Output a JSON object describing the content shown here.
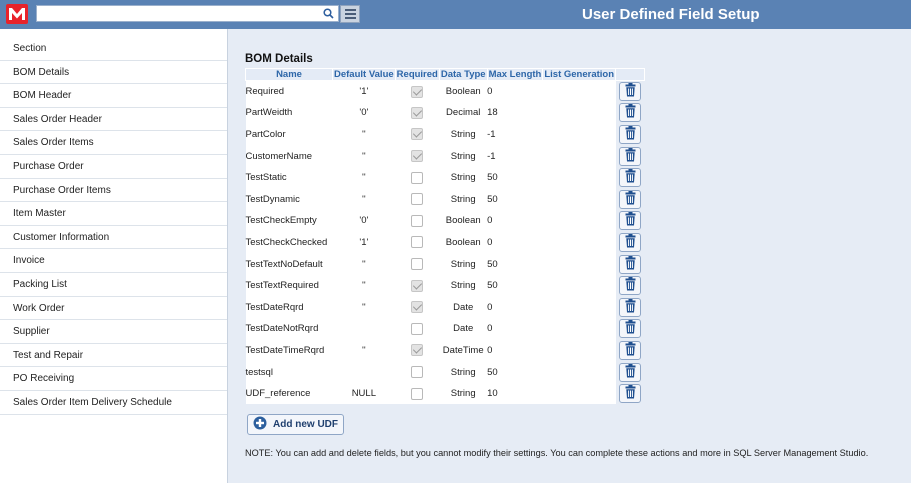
{
  "header": {
    "title": "User Defined Field Setup",
    "search_placeholder": "",
    "logo_icon": "m-logo-icon",
    "search_icon": "search-icon",
    "menu_icon": "hamburger-menu-icon"
  },
  "sidebar": {
    "items": [
      {
        "label": "Section"
      },
      {
        "label": "BOM Details"
      },
      {
        "label": "BOM Header"
      },
      {
        "label": "Sales Order Header"
      },
      {
        "label": "Sales Order Items"
      },
      {
        "label": "Purchase Order"
      },
      {
        "label": "Purchase Order Items"
      },
      {
        "label": "Item Master"
      },
      {
        "label": "Customer Information"
      },
      {
        "label": "Invoice"
      },
      {
        "label": "Packing List"
      },
      {
        "label": "Work Order"
      },
      {
        "label": "Supplier"
      },
      {
        "label": "Test and Repair"
      },
      {
        "label": "PO Receiving"
      },
      {
        "label": "Sales Order Item Delivery Schedule"
      }
    ]
  },
  "main": {
    "section_title": "BOM Details",
    "columns": [
      "Name",
      "Default Value",
      "Required",
      "Data Type",
      "Max Length",
      "List Generation"
    ],
    "rows": [
      {
        "name": "Required",
        "default": "'1'",
        "required": true,
        "type": "Boolean",
        "max": "0",
        "list": ""
      },
      {
        "name": "PartWeidth",
        "default": "'0'",
        "required": true,
        "type": "Decimal",
        "max": "18",
        "list": ""
      },
      {
        "name": "PartColor",
        "default": "''",
        "required": true,
        "type": "String",
        "max": "-1",
        "list": ""
      },
      {
        "name": "CustomerName",
        "default": "''",
        "required": true,
        "type": "String",
        "max": "-1",
        "list": ""
      },
      {
        "name": "TestStatic",
        "default": "''",
        "required": false,
        "type": "String",
        "max": "50",
        "list": ""
      },
      {
        "name": "TestDynamic",
        "default": "''",
        "required": false,
        "type": "String",
        "max": "50",
        "list": ""
      },
      {
        "name": "TestCheckEmpty",
        "default": "'0'",
        "required": false,
        "type": "Boolean",
        "max": "0",
        "list": ""
      },
      {
        "name": "TestCheckChecked",
        "default": "'1'",
        "required": false,
        "type": "Boolean",
        "max": "0",
        "list": ""
      },
      {
        "name": "TestTextNoDefault",
        "default": "''",
        "required": false,
        "type": "String",
        "max": "50",
        "list": ""
      },
      {
        "name": "TestTextRequired",
        "default": "''",
        "required": true,
        "type": "String",
        "max": "50",
        "list": ""
      },
      {
        "name": "TestDateRqrd",
        "default": "''",
        "required": true,
        "type": "Date",
        "max": "0",
        "list": ""
      },
      {
        "name": "TestDateNotRqrd",
        "default": "",
        "required": false,
        "type": "Date",
        "max": "0",
        "list": ""
      },
      {
        "name": "TestDateTimeRqrd",
        "default": "''",
        "required": true,
        "type": "DateTime",
        "max": "0",
        "list": ""
      },
      {
        "name": "testsql",
        "default": "",
        "required": false,
        "type": "String",
        "max": "50",
        "list": ""
      },
      {
        "name": "UDF_reference",
        "default": "NULL",
        "required": false,
        "type": "String",
        "max": "10",
        "list": ""
      }
    ],
    "delete_icon": "trash-icon",
    "add_button_label": "Add new UDF",
    "add_icon": "plus-icon",
    "note": "NOTE: You can add and delete fields, but you cannot modify their settings. You can complete these actions and more in SQL Server Management Studio."
  },
  "colors": {
    "header_bg": "#5a82b4",
    "logo_red": "#e8232b",
    "page_bg": "#e6ecf5",
    "column_header_text": "#2d66a8",
    "trash_blue": "#1f4f8f"
  }
}
